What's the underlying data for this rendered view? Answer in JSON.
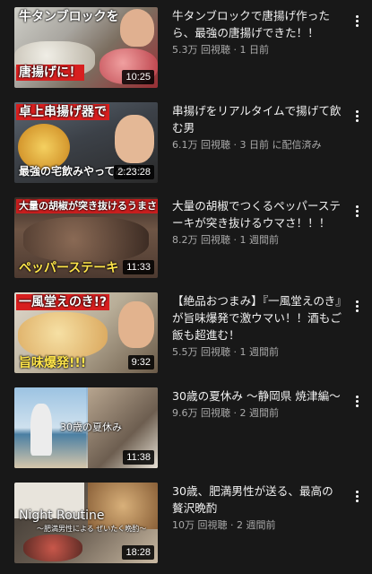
{
  "videos": [
    {
      "title": "牛タンブロックで唐揚げ作ったら、最強の唐揚げできた！！",
      "views": "5.3万 回視聴",
      "age": "1 日前",
      "duration": "10:25",
      "thumb_text": [
        "牛タンブロックを",
        "唐揚げに！"
      ]
    },
    {
      "title": "串揚げをリアルタイムで揚げて飲む男",
      "views": "6.1万 回視聴",
      "age": "3 日前 に配信済み",
      "duration": "2:23:28",
      "thumb_text": [
        "卓上串揚げ器で",
        "最強の宅飲みやってみた!"
      ]
    },
    {
      "title": "大量の胡椒でつくるペッパーステーキが突き抜けるウマさ！！！",
      "views": "8.2万 回視聴",
      "age": "1 週間前",
      "duration": "11:33",
      "thumb_text": [
        "大量の胡椒が突き抜けるうまさ",
        "ペッパーステーキ"
      ]
    },
    {
      "title": "【絶品おつまみ】『一風堂えのき』が旨味爆発で激ウマい！！酒もご飯も超進む！",
      "views": "5.5万 回視聴",
      "age": "1 週間前",
      "duration": "9:32",
      "thumb_text": [
        "一風堂えのき!?",
        "旨味爆発!!!"
      ]
    },
    {
      "title": "30歳の夏休み 〜静岡県 焼津編〜",
      "views": "9.6万 回視聴",
      "age": "2 週間前",
      "duration": "11:38",
      "thumb_text": [
        "30歳の夏休み"
      ]
    },
    {
      "title": "30歳、肥満男性が送る、最高の贅沢晩酌",
      "views": "10万 回視聴",
      "age": "2 週間前",
      "duration": "18:28",
      "thumb_text": [
        "Night Routine",
        "〜肥満男性による ぜいたく晩酌〜"
      ]
    }
  ]
}
